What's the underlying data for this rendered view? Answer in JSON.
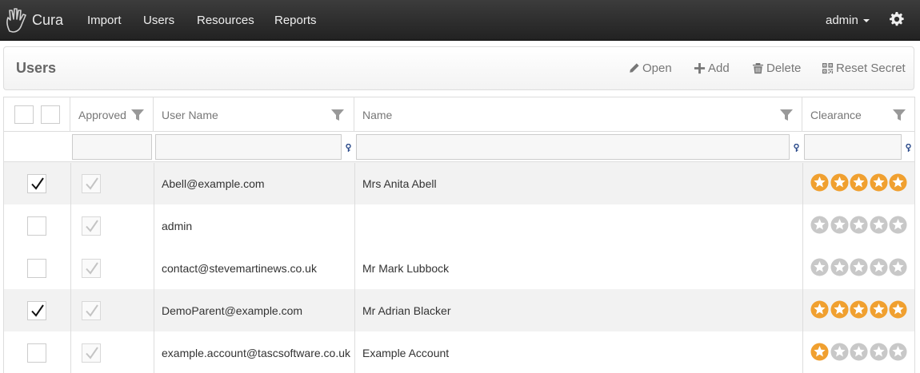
{
  "app": {
    "brand": "Cura",
    "nav": [
      "Import",
      "Users",
      "Resources",
      "Reports"
    ],
    "user_menu": "admin"
  },
  "panel": {
    "title": "Users",
    "actions": {
      "open": "Open",
      "add": "Add",
      "delete": "Delete",
      "reset_secret": "Reset Secret"
    }
  },
  "grid": {
    "columns": {
      "approved": "Approved",
      "user_name": "User Name",
      "name": "Name",
      "clearance": "Clearance"
    },
    "rows": [
      {
        "selected": true,
        "approved": true,
        "user_name": "Abell@example.com",
        "name": "Mrs Anita Abell",
        "clearance": 5
      },
      {
        "selected": false,
        "approved": true,
        "user_name": "admin",
        "name": "",
        "clearance": 0
      },
      {
        "selected": false,
        "approved": true,
        "user_name": "contact@stevemartinews.co.uk",
        "name": "Mr Mark Lubbock",
        "clearance": 0
      },
      {
        "selected": true,
        "approved": true,
        "user_name": "DemoParent@example.com",
        "name": "Mr Adrian Blacker",
        "clearance": 5
      },
      {
        "selected": false,
        "approved": true,
        "user_name": "example.account@tascsoftware.co.uk",
        "name": "Example Account",
        "clearance": 1
      }
    ],
    "clearance_max": 5
  },
  "colors": {
    "star_on": "#f0a030",
    "star_off": "#c8c8c8",
    "navbar": "#2b2b2b"
  },
  "icons": {
    "brand": "hand-logo-icon",
    "settings": "gear-icon",
    "open": "pencil-icon",
    "add": "plus-icon",
    "delete": "trash-icon",
    "reset_secret": "qr-code-icon",
    "filter": "funnel-icon",
    "filter_clear": "key-icon"
  }
}
